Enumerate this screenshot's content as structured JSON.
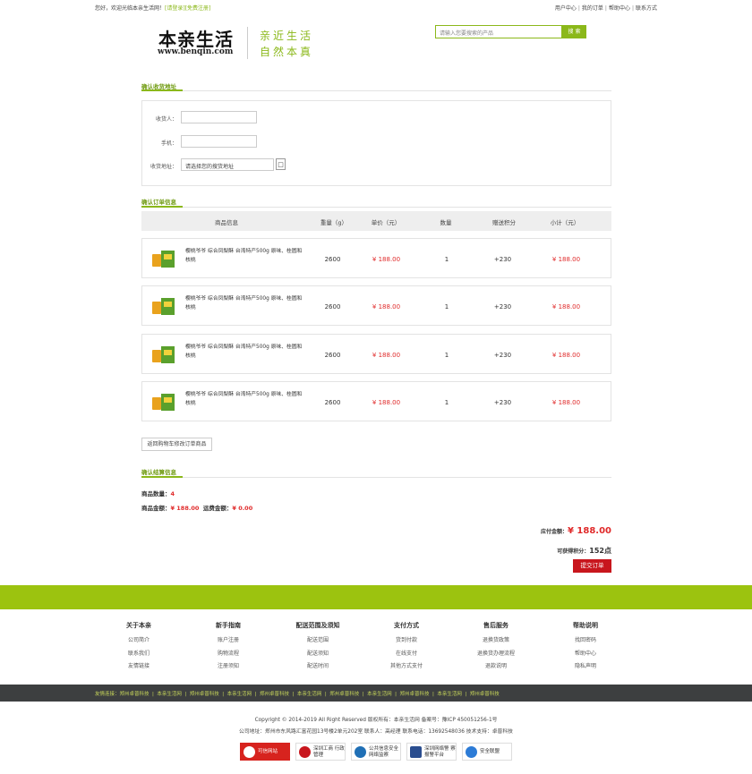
{
  "topbar": {
    "welcome": "您好，欢迎光临本亲生活网！",
    "login": "[请登录]",
    "register": "[免费注册]",
    "links": [
      "用户中心",
      "我的订单",
      "帮助中心",
      "联系方式"
    ]
  },
  "header": {
    "logo_cn": "本亲生活",
    "logo_url": "www.benqin.com",
    "slogan_1": "亲近生活",
    "slogan_2": "自然本真",
    "search_placeholder": "请输入您要搜索的产品",
    "search_button": "搜 索"
  },
  "address": {
    "section_title": "确认收货地址",
    "receiver_label": "收货人：",
    "phone_label": "手机：",
    "address_label": "收货地址：",
    "address_select": "请选择您的搜货地址",
    "receiver_value": "",
    "phone_value": ""
  },
  "order": {
    "section_title": "确认订单信息",
    "columns": [
      "商品信息",
      "重量（g）",
      "单价（元）",
      "数量",
      "赠送积分",
      "小计（元）"
    ],
    "rows": [
      {
        "name": "樱桃爷爷 综合凤梨酥 台湾特产500g 原味、桂圆和核桃",
        "weight": "2600",
        "price": "¥ 188.00",
        "qty": "1",
        "points": "+230",
        "subtotal": "¥ 188.00"
      },
      {
        "name": "樱桃爷爷 综合凤梨酥 台湾特产500g 原味、桂圆和核桃",
        "weight": "2600",
        "price": "¥ 188.00",
        "qty": "1",
        "points": "+230",
        "subtotal": "¥ 188.00"
      },
      {
        "name": "樱桃爷爷 综合凤梨酥 台湾特产500g 原味、桂圆和核桃",
        "weight": "2600",
        "price": "¥ 188.00",
        "qty": "1",
        "points": "+230",
        "subtotal": "¥ 188.00"
      },
      {
        "name": "樱桃爷爷 综合凤梨酥 台湾特产500g 原味、桂圆和核桃",
        "weight": "2600",
        "price": "¥ 188.00",
        "qty": "1",
        "points": "+230",
        "subtotal": "¥ 188.00"
      }
    ],
    "back_button": "返回购物车修改订单商品"
  },
  "settlement": {
    "section_title": "确认结算信息",
    "count_label": "商品数量：",
    "count_value": "4",
    "amount_label": "商品金额：",
    "amount_value": "¥ 188.00",
    "shipping_label": "运费金额：",
    "shipping_value": "¥ 0.00",
    "payable_label": "应付金额：",
    "payable_value": "¥ 188.00",
    "points_label": "可获得积分：",
    "points_value": "152点",
    "submit_button": "提交订单"
  },
  "footer": {
    "columns": [
      {
        "title": "关于本亲",
        "items": [
          "公司简介",
          "联系我们",
          "友情链接"
        ]
      },
      {
        "title": "新手指南",
        "items": [
          "账户注册",
          "购物流程",
          "注册须知"
        ]
      },
      {
        "title": "配送范围及须知",
        "items": [
          "配送范围",
          "配送须知",
          "配送时间"
        ]
      },
      {
        "title": "支付方式",
        "items": [
          "货到付款",
          "在线支付",
          "其他方式支付"
        ]
      },
      {
        "title": "售后服务",
        "items": [
          "退换货政策",
          "退换货办理流程",
          "退款说明"
        ]
      },
      {
        "title": "帮助说明",
        "items": [
          "找回密码",
          "帮助中心",
          "隐私声明"
        ]
      }
    ],
    "links_label": "友情连接：",
    "links": [
      "郑州卓普科技",
      "本亲生活网",
      "郑州卓普科技",
      "本亲生活网",
      "郑州卓普科技",
      "本亲生活网",
      "郑州卓普科技",
      "本亲生活网",
      "郑州卓普科技",
      "本亲生活网",
      "郑州卓普科技"
    ],
    "copyright": "Copyright © 2014-2019 All Right Reserved 版权所有：本亲生活网 备案号：豫ICP 450051256-1号",
    "address": "公司地址：郑州市东风路汇富花园13号楼2单元202室 联系人：高经理 联系电话：13692548036 技术支持：卓普科技",
    "badges": [
      {
        "label": "可信网站",
        "color": "#d7231e"
      },
      {
        "label": "深圳工商 行政管理",
        "color": "#c8161d"
      },
      {
        "label": "公共信息安全 网络监察",
        "color": "#1f6fb5"
      },
      {
        "label": "深圳网络警 察报警平台",
        "color": "#2a4d8f"
      },
      {
        "label": "安全联盟",
        "color": "#2c7bd6"
      }
    ]
  }
}
